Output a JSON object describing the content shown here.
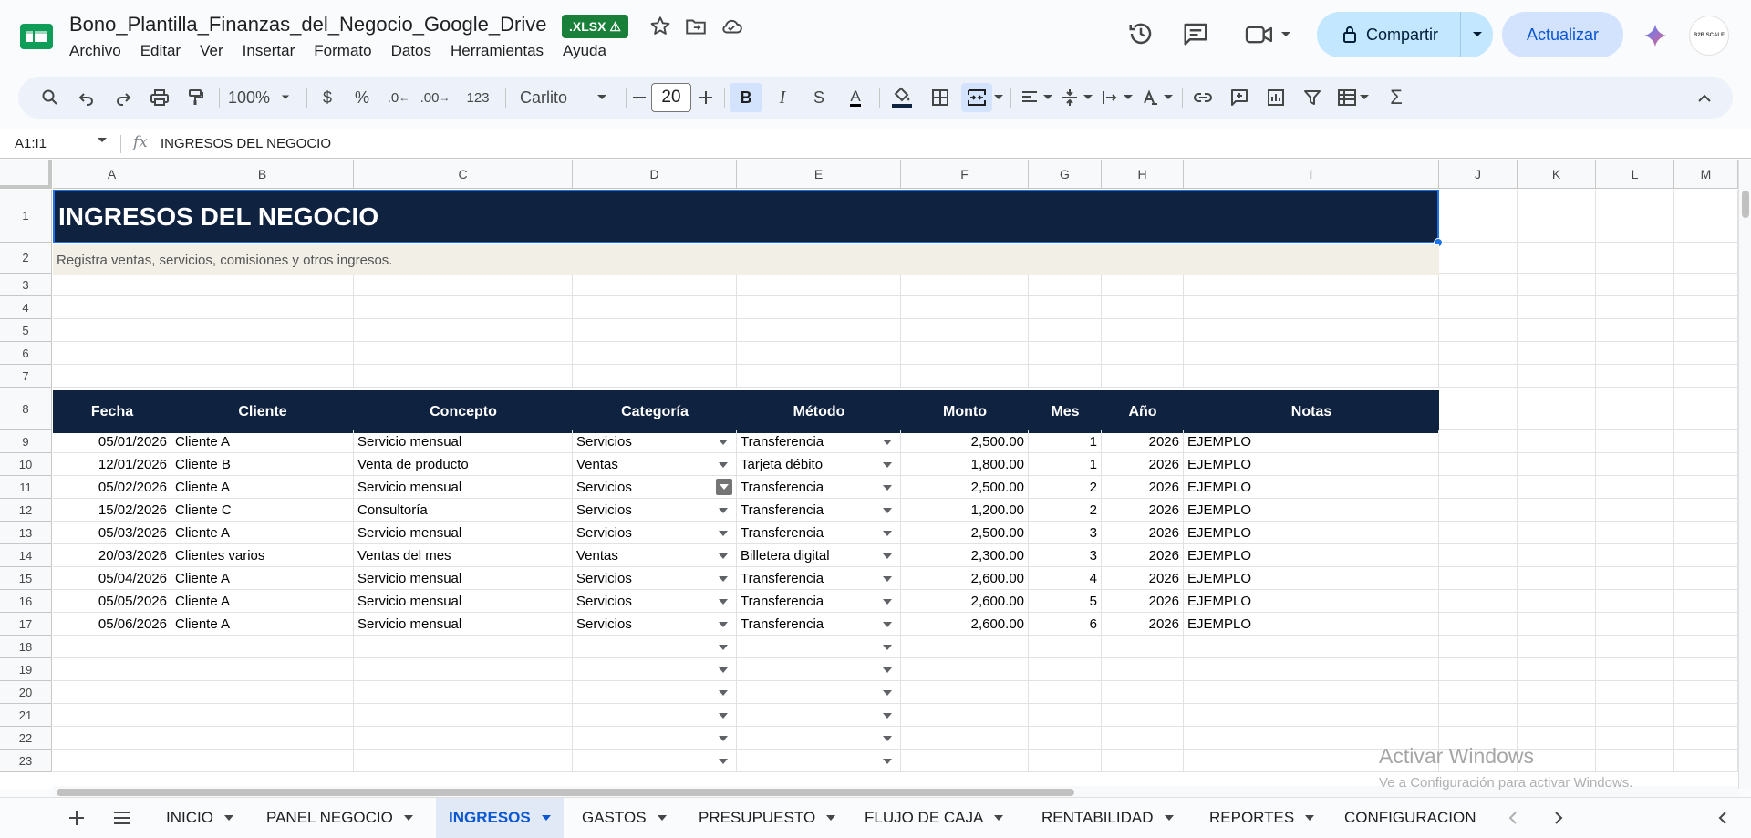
{
  "app": {
    "doc_title": "Bono_Plantilla_Finanzas_del_Negocio_Google_Drive",
    "badge": ".XLSX ⚠",
    "menu": [
      "Archivo",
      "Editar",
      "Ver",
      "Insertar",
      "Formato",
      "Datos",
      "Herramientas",
      "Ayuda"
    ],
    "share_label": "Compartir",
    "update_label": "Actualizar",
    "avatar_text": "B2B SCALE",
    "accent": "#c2e7ff"
  },
  "toolbar": {
    "zoom": "100%",
    "currency": "$",
    "percent": "%",
    "dec_less": ".0",
    "dec_more": ".00",
    "number_format": "123",
    "font": "Carlito",
    "font_size": "20",
    "bold": "B",
    "italic": "I",
    "strike": "S",
    "text_color": "A"
  },
  "formula_bar": {
    "name_box": "A1:I1",
    "fx": "fx",
    "formula": "INGRESOS DEL NEGOCIO"
  },
  "columns": [
    "A",
    "B",
    "C",
    "D",
    "E",
    "F",
    "G",
    "H",
    "I",
    "J",
    "K",
    "L",
    "M"
  ],
  "rows": [
    "1",
    "2",
    "3",
    "4",
    "5",
    "6",
    "7",
    "8",
    "9",
    "10",
    "11",
    "12",
    "13",
    "14",
    "15",
    "16",
    "17",
    "18",
    "19",
    "20",
    "21",
    "22",
    "23"
  ],
  "sheet": {
    "title": "INGRESOS DEL NEGOCIO",
    "subtitle": "Registra ventas, servicios, comisiones y otros ingresos.",
    "title_bg": "#0f2240",
    "subtitle_bg": "#f2efe6",
    "headers": [
      "Fecha",
      "Cliente",
      "Concepto",
      "Categoría",
      "Método",
      "Monto",
      "Mes",
      "Año",
      "Notas"
    ],
    "data": [
      [
        "05/01/2026",
        "Cliente A",
        "Servicio mensual",
        "Servicios",
        "Transferencia",
        "2,500.00",
        "1",
        "2026",
        "EJEMPLO"
      ],
      [
        "12/01/2026",
        "Cliente B",
        "Venta de producto",
        "Ventas",
        "Tarjeta débito",
        "1,800.00",
        "1",
        "2026",
        "EJEMPLO"
      ],
      [
        "05/02/2026",
        "Cliente A",
        "Servicio mensual",
        "Servicios",
        "Transferencia",
        "2,500.00",
        "2",
        "2026",
        "EJEMPLO"
      ],
      [
        "15/02/2026",
        "Cliente C",
        "Consultoría",
        "Servicios",
        "Transferencia",
        "1,200.00",
        "2",
        "2026",
        "EJEMPLO"
      ],
      [
        "05/03/2026",
        "Cliente A",
        "Servicio mensual",
        "Servicios",
        "Transferencia",
        "2,500.00",
        "3",
        "2026",
        "EJEMPLO"
      ],
      [
        "20/03/2026",
        "Clientes varios",
        "Ventas del mes",
        "Ventas",
        "Billetera digital",
        "2,300.00",
        "3",
        "2026",
        "EJEMPLO"
      ],
      [
        "05/04/2026",
        "Cliente A",
        "Servicio mensual",
        "Servicios",
        "Transferencia",
        "2,600.00",
        "4",
        "2026",
        "EJEMPLO"
      ],
      [
        "05/05/2026",
        "Cliente A",
        "Servicio mensual",
        "Servicios",
        "Transferencia",
        "2,600.00",
        "5",
        "2026",
        "EJEMPLO"
      ],
      [
        "05/06/2026",
        "Cliente A",
        "Servicio mensual",
        "Servicios",
        "Transferencia",
        "2,600.00",
        "6",
        "2026",
        "EJEMPLO"
      ]
    ]
  },
  "watermark": {
    "line1": "Activar Windows",
    "line2": "Ve a Configuración para activar Windows."
  },
  "tabs": [
    "INICIO",
    "PANEL NEGOCIO",
    "INGRESOS",
    "GASTOS",
    "PRESUPUESTO",
    "FLUJO DE CAJA",
    "RENTABILIDAD",
    "REPORTES",
    "CONFIGURACION"
  ],
  "active_tab": "INGRESOS"
}
